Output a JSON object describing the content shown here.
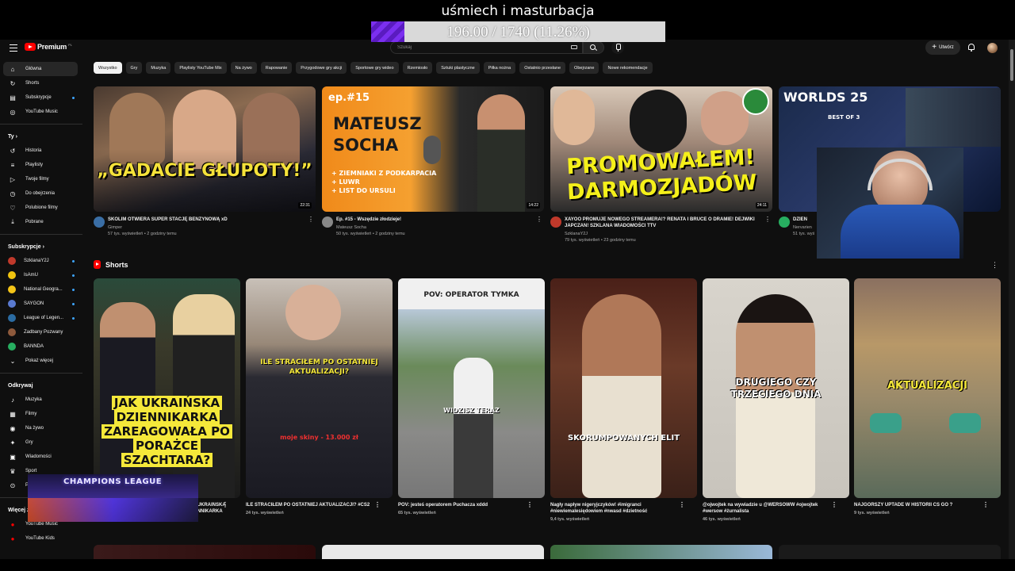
{
  "overlay": {
    "title": "uśmiech i masturbacja",
    "progress_text": "196.00 / 1740 (11.26%)",
    "progress_fraction": 0.1126,
    "fill_color": "#7b2ff0"
  },
  "topbar": {
    "logo_text": "Premium",
    "logo_sup": "PL",
    "search_placeholder": "Szukaj",
    "create_label": "Utwórz"
  },
  "sidebar": {
    "main": [
      {
        "label": "Główna",
        "icon": "home-icon"
      },
      {
        "label": "Shorts",
        "icon": "shorts-icon"
      },
      {
        "label": "Subskrypcje",
        "icon": "subscriptions-icon"
      },
      {
        "label": "YouTube Music",
        "icon": "music-icon"
      }
    ],
    "you_heading": "Ty",
    "you": [
      {
        "label": "Historia",
        "icon": "history-icon"
      },
      {
        "label": "Playlisty",
        "icon": "playlist-icon"
      },
      {
        "label": "Twoje filmy",
        "icon": "video-icon"
      },
      {
        "label": "Do obejrzenia",
        "icon": "clock-icon"
      },
      {
        "label": "Polubione filmy",
        "icon": "like-icon"
      },
      {
        "label": "Pobrane",
        "icon": "download-icon"
      }
    ],
    "subs_heading": "Subskrypcje",
    "subs": [
      {
        "label": "SzklanaY2J",
        "color": "#c0392b"
      },
      {
        "label": "IsAmU",
        "color": "#f1c40f"
      },
      {
        "label": "National Geogra...",
        "color": "#f5c518"
      },
      {
        "label": "SAYGON",
        "color": "#5a7ad0"
      },
      {
        "label": "League of Legen...",
        "color": "#2b6ca3"
      },
      {
        "label": "Zadbany Pozwany",
        "color": "#8e5a3c"
      },
      {
        "label": "BANNDA",
        "color": "#27ae60"
      },
      {
        "label": "Pokaż więcej",
        "color": ""
      }
    ],
    "explore_heading": "Odkrywaj",
    "explore": [
      {
        "label": "Muzyka",
        "icon": "music-note-icon"
      },
      {
        "label": "Filmy",
        "icon": "film-icon"
      },
      {
        "label": "Na żywo",
        "icon": "live-icon"
      },
      {
        "label": "Gry",
        "icon": "gamepad-icon"
      },
      {
        "label": "Wiadomości",
        "icon": "news-icon"
      },
      {
        "label": "Sport",
        "icon": "trophy-icon"
      },
      {
        "label": "P",
        "icon": "podcast-icon"
      }
    ],
    "more_heading": "Więcej z",
    "more": [
      {
        "label": "YouTube Music"
      },
      {
        "label": "YouTube Kids"
      }
    ]
  },
  "chips": [
    "Wszystko",
    "Gry",
    "Muzyka",
    "Playlisty YouTube Mix",
    "Na żywo",
    "Rapowanie",
    "Przygodowe gry akcji",
    "Sportowe gry wideo",
    "Rzemiosło",
    "Sztuki plastyczne",
    "Piłka nożna",
    "Ostatnio przesłane",
    "Obejrzane",
    "Nowe rekomendacje"
  ],
  "videos": [
    {
      "title": "SKOLIM OTWIERA SUPER STACJĘ BENZYNOWĄ xD",
      "channel": "Gimper",
      "stats": "57 tys. wyświetleń • 2 godziny temu",
      "duration": "22:31",
      "thumb_text": "„GADACIE GŁUPOTY!”",
      "avatar_color": "#3a6ea5"
    },
    {
      "title": "Ep. #15 - Wszędzie złodzieje!",
      "channel": "Mateusz Socha",
      "stats": "50 tys. wyświetleń • 2 godziny temu",
      "duration": "14:22",
      "thumb_text": "MATEUSZ SOCHA",
      "thumb_sub": "ep.#15",
      "thumb_list": [
        "+ ZIEMNIAKI Z PODKARPACIA",
        "+ LUWR",
        "+ LIST DO URSULI"
      ],
      "avatar_color": "#888888"
    },
    {
      "title": "XAYOO PROMUJE NOWEGO STREAMERA!? RENATA I BRUCE O DRAMIE! DEJWIKI JAPCZAN! SZKLANA WIADOMOŚCI TTV",
      "channel": "SzklanaY2J",
      "stats": "79 tys. wyświetleń • 23 godziny temu",
      "duration": "24:11",
      "thumb_text": "PROMOWAŁEM! DARMOZJADÓW",
      "avatar_color": "#c0392b"
    },
    {
      "title": "DZIEN",
      "channel": "Nervarien",
      "stats": "51 tys. wyś",
      "duration": "",
      "thumb_text": "WORLDS 25",
      "thumb_sub": "BEST OF 3",
      "avatar_color": "#27ae60"
    }
  ],
  "shorts_heading": "Shorts",
  "shorts": [
    {
      "title": "JAK UKRAIŃSKA DZIENNIKARKA ZAREAGOWAŁA PO PORAŻCE SZACHTARA? porażkę #legia",
      "views": "",
      "caption": "JAK UKRAIŃSKA DZIENNIKARKA ZAREAGOWAŁA PO PORAŻCE SZACHTARA?"
    },
    {
      "title": "ILE STRACIŁEM PO OSTATNIEJ AKTUALIZACJI? #CS2",
      "views": "24 tys. wyświetleń",
      "caption": "ILE STRACIŁEM PO OSTATNIEJ AKTUALIZACJI?",
      "caption2": "moje skiny - 13.000 zł"
    },
    {
      "title": "POV: jesteś operatorem Puchacza xddd",
      "views": "65 tys. wyświetleń",
      "caption": "POV: OPERATOR TYMKA",
      "caption2": "WIDZISZ TERAZ"
    },
    {
      "title": "Nagły napływ nigeryjczyków! #imigranci #niewiemalesiędowiem #nwasd #dzietność",
      "views": "9,4 tys. wyświetleń",
      "caption": "SKORUMPOWANYCH ELIT"
    },
    {
      "title": "@ojwojtek na wywiadzie u @WERSOWW #ojwojtek #wersow #żurnalista",
      "views": "46 tys. wyświetleń",
      "caption": "DRUGIEGO CZY TRZECIEGO DNIA"
    },
    {
      "title": "NAJGORSZY UPTADE W HISTORII CS GO ?",
      "views": "9 tys. wyświetleń",
      "caption": "AKTUALIZACJI"
    }
  ],
  "champions_overlay": "CHAMPIONS LEAGUE"
}
